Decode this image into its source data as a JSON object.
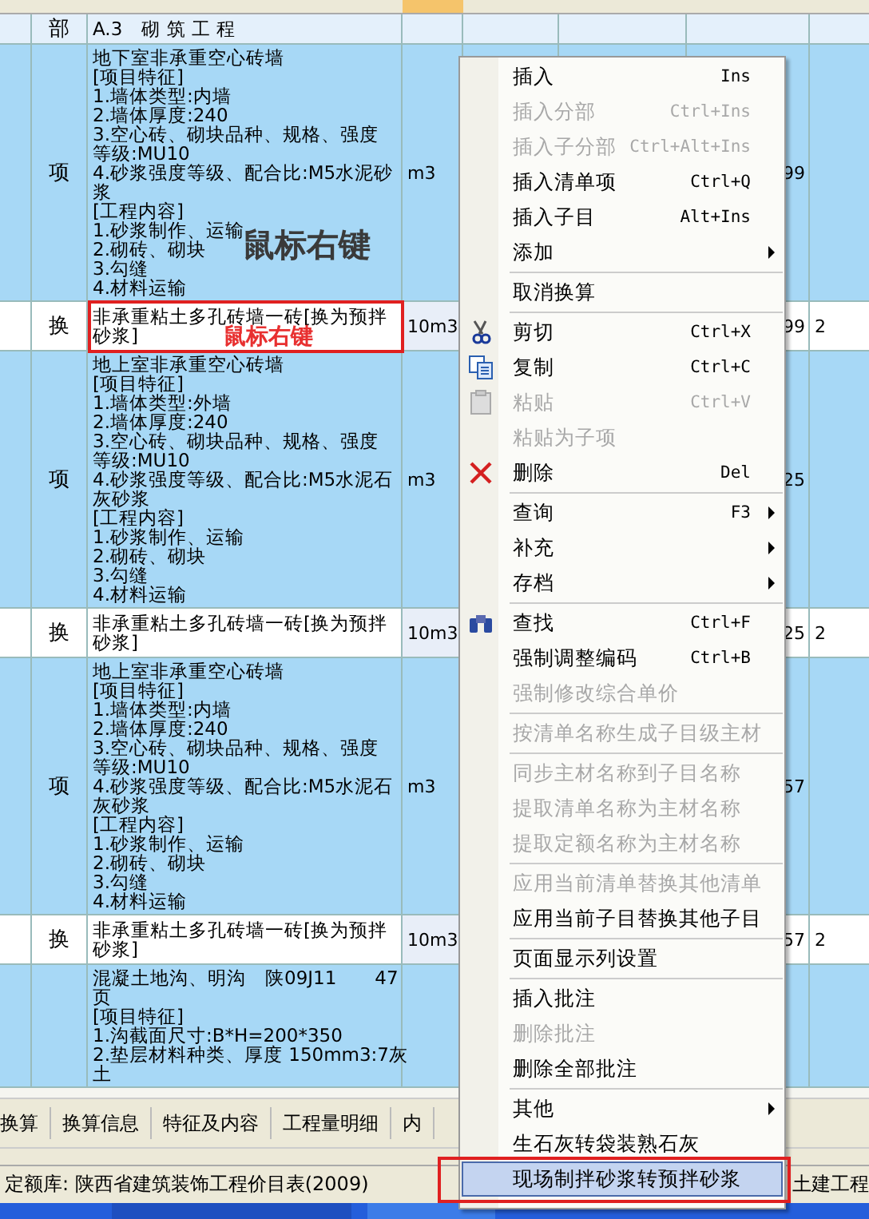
{
  "table": {
    "rows": [
      {
        "kind": "section",
        "type": "部",
        "name_lines": [
          "A.3　砌 筑 工 程"
        ],
        "unit": "",
        "qty": "",
        "col8": ""
      },
      {
        "kind": "item",
        "type": "项",
        "name_lines": [
          "地下室非承重空心砖墙",
          "[项目特征]",
          "1.墙体类型:内墙",
          "2.墙体厚度:240",
          "3.空心砖、砌块品种、规格、强度",
          "等级:MU10",
          "4.砂浆强度等级、配合比:M5水泥砂",
          "浆",
          "[工程内容]",
          "1.砂浆制作、运输",
          "2.砌砖、砌块",
          "3.勾缝",
          "4.材料运输"
        ],
        "unit": "m3",
        "qty": "99",
        "col8": ""
      },
      {
        "kind": "sub",
        "type": "换",
        "name_lines": [
          "非承重粘土多孔砖墙一砖[换为预拌",
          "砂浆]"
        ],
        "unit": "10m3",
        "qty": "99",
        "col8": "2"
      },
      {
        "kind": "item",
        "type": "项",
        "name_lines": [
          "地上室非承重空心砖墙",
          "[项目特征]",
          "1.墙体类型:外墙",
          "2.墙体厚度:240",
          "3.空心砖、砌块品种、规格、强度",
          "等级:MU10",
          "4.砂浆强度等级、配合比:M5水泥石",
          "灰砂浆",
          "[工程内容]",
          "1.砂浆制作、运输",
          "2.砌砖、砌块",
          "3.勾缝",
          "4.材料运输"
        ],
        "unit": "m3",
        "qty": "25",
        "col8": ""
      },
      {
        "kind": "sub",
        "type": "换",
        "name_lines": [
          "非承重粘土多孔砖墙一砖[换为预拌",
          "砂浆]"
        ],
        "unit": "10m3",
        "qty": "25",
        "col8": "2"
      },
      {
        "kind": "item",
        "type": "项",
        "name_lines": [
          "地上室非承重空心砖墙",
          "[项目特征]",
          "1.墙体类型:内墙",
          "2.墙体厚度:240",
          "3.空心砖、砌块品种、规格、强度",
          "等级:MU10",
          "4.砂浆强度等级、配合比:M5水泥石",
          "灰砂浆",
          "[工程内容]",
          "1.砂浆制作、运输",
          "2.砌砖、砌块",
          "3.勾缝",
          "4.材料运输"
        ],
        "unit": "m3",
        "qty": "57",
        "col8": ""
      },
      {
        "kind": "sub",
        "type": "换",
        "name_lines": [
          "非承重粘土多孔砖墙一砖[换为预拌",
          "砂浆]"
        ],
        "unit": "10m3",
        "qty": "57",
        "col8": "2"
      },
      {
        "kind": "item",
        "type": "",
        "name_lines": [
          "混凝土地沟、明沟　陕09J11　　47",
          "页",
          "[项目特征]",
          "1.沟截面尺寸:B*H=200*350",
          "2.垫层材料种类、厚度 150mm3:7灰",
          "土"
        ],
        "unit": "",
        "qty": "",
        "col8": ""
      }
    ]
  },
  "annotations": {
    "gray_note": "鼠标右键",
    "boxed_note": "鼠标右键"
  },
  "context_menu": {
    "items": [
      {
        "kind": "item",
        "label": "插入",
        "shortcut": "Ins",
        "disabled": false,
        "submenu": false,
        "selected": false
      },
      {
        "kind": "item",
        "label": "插入分部",
        "shortcut": "Ctrl+Ins",
        "disabled": true,
        "submenu": false,
        "selected": false
      },
      {
        "kind": "item",
        "label": "插入子分部",
        "shortcut": "Ctrl+Alt+Ins",
        "disabled": true,
        "submenu": false,
        "selected": false
      },
      {
        "kind": "item",
        "label": "插入清单项",
        "shortcut": "Ctrl+Q",
        "disabled": false,
        "submenu": false,
        "selected": false
      },
      {
        "kind": "item",
        "label": "插入子目",
        "shortcut": "Alt+Ins",
        "disabled": false,
        "submenu": false,
        "selected": false
      },
      {
        "kind": "item",
        "label": "添加",
        "disabled": false,
        "submenu": true,
        "selected": false
      },
      {
        "kind": "separator"
      },
      {
        "kind": "item",
        "label": "取消换算",
        "disabled": false,
        "submenu": false,
        "selected": false
      },
      {
        "kind": "separator"
      },
      {
        "kind": "cut",
        "label": "剪切",
        "shortcut": "Ctrl+X",
        "disabled": false,
        "submenu": false,
        "selected": false
      },
      {
        "kind": "copy",
        "label": "复制",
        "shortcut": "Ctrl+C",
        "disabled": false,
        "submenu": false,
        "selected": false
      },
      {
        "kind": "paste",
        "label": "粘贴",
        "shortcut": "Ctrl+V",
        "disabled": true,
        "submenu": false,
        "selected": false
      },
      {
        "kind": "item",
        "label": "粘贴为子项",
        "disabled": true,
        "submenu": false,
        "selected": false
      },
      {
        "kind": "delete",
        "label": "删除",
        "shortcut": "Del",
        "disabled": false,
        "submenu": false,
        "selected": false
      },
      {
        "kind": "separator"
      },
      {
        "kind": "item",
        "label": "查询",
        "shortcut": "F3",
        "disabled": false,
        "submenu": true,
        "selected": false
      },
      {
        "kind": "item",
        "label": "补充",
        "disabled": false,
        "submenu": true,
        "selected": false
      },
      {
        "kind": "item",
        "label": "存档",
        "disabled": false,
        "submenu": true,
        "selected": false
      },
      {
        "kind": "separator"
      },
      {
        "kind": "find",
        "label": "查找",
        "shortcut": "Ctrl+F",
        "disabled": false,
        "submenu": false,
        "selected": false
      },
      {
        "kind": "item",
        "label": "强制调整编码",
        "shortcut": "Ctrl+B",
        "disabled": false,
        "submenu": false,
        "selected": false
      },
      {
        "kind": "item",
        "label": "强制修改综合单价",
        "disabled": true,
        "submenu": false,
        "selected": false
      },
      {
        "kind": "separator"
      },
      {
        "kind": "item",
        "label": "按清单名称生成子目级主材",
        "disabled": true,
        "submenu": false,
        "selected": false
      },
      {
        "kind": "separator"
      },
      {
        "kind": "item",
        "label": "同步主材名称到子目名称",
        "disabled": true,
        "submenu": false,
        "selected": false
      },
      {
        "kind": "item",
        "label": "提取清单名称为主材名称",
        "disabled": true,
        "submenu": false,
        "selected": false
      },
      {
        "kind": "item",
        "label": "提取定额名称为主材名称",
        "disabled": true,
        "submenu": false,
        "selected": false
      },
      {
        "kind": "separator"
      },
      {
        "kind": "item",
        "label": "应用当前清单替换其他清单",
        "disabled": true,
        "submenu": false,
        "selected": false
      },
      {
        "kind": "item",
        "label": "应用当前子目替换其他子目",
        "disabled": false,
        "submenu": false,
        "selected": false
      },
      {
        "kind": "separator"
      },
      {
        "kind": "item",
        "label": "页面显示列设置",
        "disabled": false,
        "submenu": false,
        "selected": false
      },
      {
        "kind": "separator"
      },
      {
        "kind": "item",
        "label": "插入批注",
        "disabled": false,
        "submenu": false,
        "selected": false
      },
      {
        "kind": "item",
        "label": "删除批注",
        "disabled": true,
        "submenu": false,
        "selected": false
      },
      {
        "kind": "item",
        "label": "删除全部批注",
        "disabled": false,
        "submenu": false,
        "selected": false
      },
      {
        "kind": "separator"
      },
      {
        "kind": "item",
        "label": "其他",
        "disabled": false,
        "submenu": true,
        "selected": false
      },
      {
        "kind": "item",
        "label": "生石灰转袋装熟石灰",
        "disabled": false,
        "submenu": false,
        "selected": false
      },
      {
        "kind": "item",
        "label": "现场制拌砂浆转预拌砂浆",
        "disabled": false,
        "submenu": false,
        "selected": true
      }
    ]
  },
  "bottom_tabs": [
    {
      "label": "换算",
      "selected": false
    },
    {
      "label": "换算信息",
      "selected": false
    },
    {
      "label": "特征及内容",
      "selected": false
    },
    {
      "label": "工程量明细",
      "selected": false
    },
    {
      "label": "内",
      "selected": false
    }
  ],
  "status_bar": {
    "library": "定额库: 陕西省建筑装饰工程价目表(2009)",
    "right": "土建工程"
  }
}
